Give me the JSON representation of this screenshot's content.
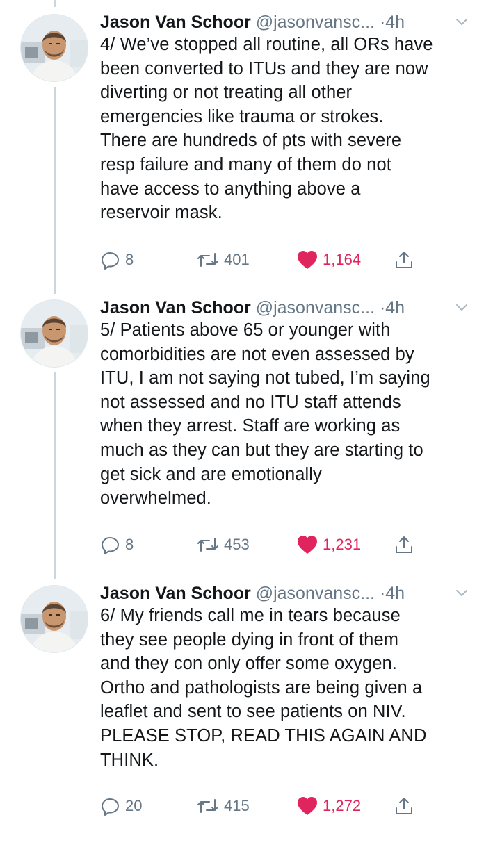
{
  "tweets": [
    {
      "author_name": "Jason Van Schoor",
      "handle": "@jasonvansc...",
      "separator": "·",
      "time": "4h",
      "lines": [
        "4/ We’ve stopped all routine, all ORs have",
        "been converted to ITUs and they are now",
        "diverting or not treating all other",
        "emergencies like trauma or strokes.",
        "There are hundreds of pts with severe",
        "resp failure and many of them do not",
        "have access to anything above a",
        "reservoir mask."
      ],
      "replies": "8",
      "retweets": "401",
      "likes": "1,164"
    },
    {
      "author_name": "Jason Van Schoor",
      "handle": "@jasonvansc...",
      "separator": "·",
      "time": "4h",
      "lines": [
        "5/ Patients above 65 or younger with",
        "comorbidities are not even assessed by",
        "ITU, I am not saying not tubed, I’m saying",
        "not assessed and no ITU staff attends",
        "when they arrest. Staff are working as",
        "much as they can but they are starting to",
        "get sick and are emotionally",
        "overwhelmed."
      ],
      "replies": "8",
      "retweets": "453",
      "likes": "1,231"
    },
    {
      "author_name": "Jason Van Schoor",
      "handle": "@jasonvansc...",
      "separator": "·",
      "time": "4h",
      "lines": [
        "6/ My friends call me in tears because",
        "they see people dying in front of them",
        "and they con only offer some oxygen.",
        "Ortho and pathologists are being given a",
        "leaflet and sent to see patients on NIV.",
        "PLEASE STOP, READ THIS AGAIN AND",
        "THINK."
      ],
      "replies": "20",
      "retweets": "415",
      "likes": "1,272"
    }
  ],
  "colors": {
    "text": "#14171a",
    "secondary": "#657786",
    "like": "#e0245e",
    "thread_line": "#ccd6dd"
  },
  "icons": [
    "reply-icon",
    "retweet-icon",
    "heart-icon",
    "share-icon",
    "chevron-down-icon"
  ]
}
